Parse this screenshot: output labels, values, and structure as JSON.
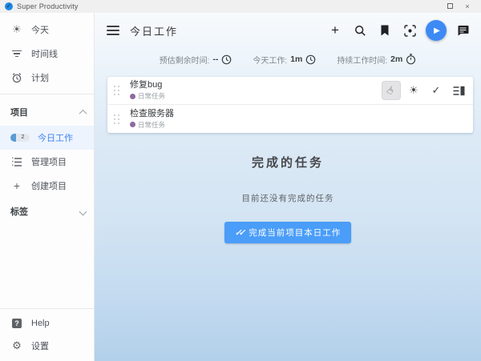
{
  "titlebar": {
    "app_title": "Super Productivity",
    "close_label": "×"
  },
  "sidebar": {
    "nav": [
      {
        "label": "今天",
        "icon": "sun-icon"
      },
      {
        "label": "时间线",
        "icon": "timeline-icon"
      },
      {
        "label": "计划",
        "icon": "alarm-clock-icon"
      }
    ],
    "projects_header": {
      "label": "项目",
      "state": "expanded"
    },
    "project_items": [
      {
        "label": "今日工作",
        "badge": "2",
        "selected": true
      },
      {
        "label": "管理项目",
        "icon": "list-icon"
      },
      {
        "label": "创建项目",
        "icon": "plus-icon"
      }
    ],
    "tags_header": {
      "label": "标签",
      "state": "collapsed"
    },
    "footer": [
      {
        "label": "Help",
        "icon": "help-icon"
      },
      {
        "label": "设置",
        "icon": "gear-icon"
      }
    ]
  },
  "header": {
    "title": "今日工作",
    "icons": [
      "plus-icon",
      "search-icon",
      "bookmark-icon",
      "focus-mode-icon",
      "play-icon",
      "notes-icon"
    ]
  },
  "stats": [
    {
      "label": "预估剩余时间:",
      "value": "--",
      "icon": "clock-icon"
    },
    {
      "label": "今天工作:",
      "value": "1m",
      "icon": "clock-icon"
    },
    {
      "label": "持续工作时间:",
      "value": "2m",
      "icon": "stopwatch-icon"
    }
  ],
  "tasks": [
    {
      "title": "修复bug",
      "tag": "日常任务",
      "hovered_action": "pointer"
    },
    {
      "title": "检查服务器",
      "tag": "日常任务"
    }
  ],
  "done_section": {
    "heading": "完成的任务",
    "empty_text": "目前还没有完成的任务",
    "finish_button": "完成当前项目本日工作"
  },
  "glyphs": {
    "logo": "✓",
    "play": "▶",
    "check": "✓",
    "double_check": "✓✓",
    "sun": "☀",
    "pointer": "☞",
    "gear": "⚙",
    "plus_small": "+",
    "plus_big": "+",
    "question": "?",
    "close": "×"
  },
  "colors": {
    "accent_blue": "#3d8af5",
    "button_blue": "#4a9df8",
    "selected_text": "#4285f4",
    "tag_purple": "#8d6a9f",
    "titlebar_bg": "#f0f0f0",
    "main_gradient_bottom": "#b2d0ea"
  }
}
